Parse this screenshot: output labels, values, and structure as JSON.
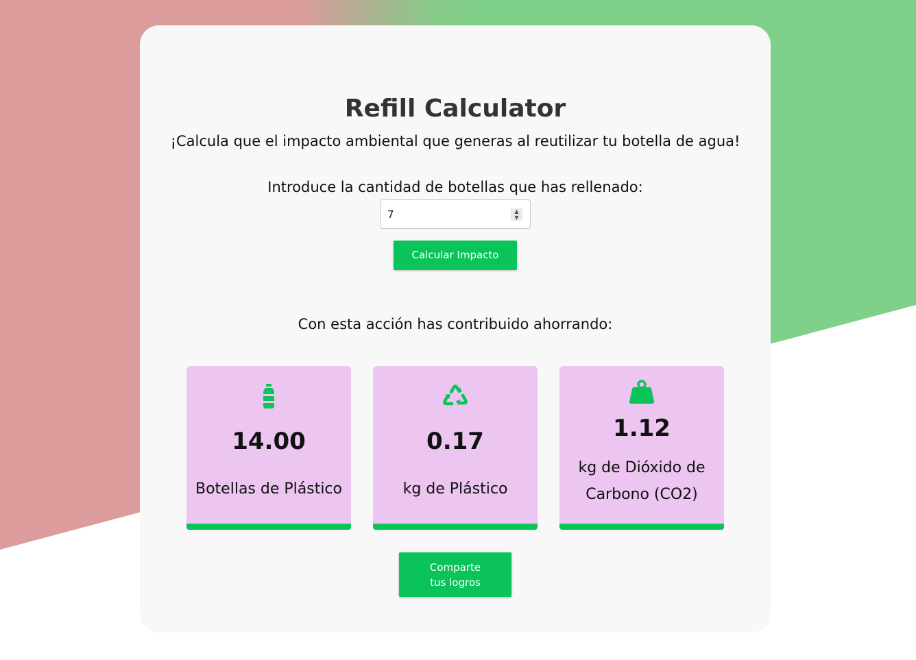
{
  "header": {
    "title": "Refill Calculator",
    "subtitle": "¡Calcula que el impacto ambiental que generas al reutilizar tu botella de agua!"
  },
  "form": {
    "label": "Introduce la cantidad de botellas que has rellenado:",
    "value": "7",
    "button": "Calcular Impacto"
  },
  "results": {
    "heading": "Con esta acción has contribuido ahorrando:",
    "cards": [
      {
        "icon": "bottle-icon",
        "value": "14.00",
        "label": "Botellas de Plástico"
      },
      {
        "icon": "recycle-icon",
        "value": "0.17",
        "label": "kg de Plástico"
      },
      {
        "icon": "weight-icon",
        "value": "1.12",
        "label": "kg de Dióxido de Carbono (CO2)"
      }
    ]
  },
  "share": {
    "line1": "Comparte",
    "line2": "tus logros"
  },
  "colors": {
    "accent": "#0ac45a",
    "card_bg": "#ecc5f0",
    "bg_left": "#dc9c9c",
    "bg_right": "#7fd189"
  }
}
